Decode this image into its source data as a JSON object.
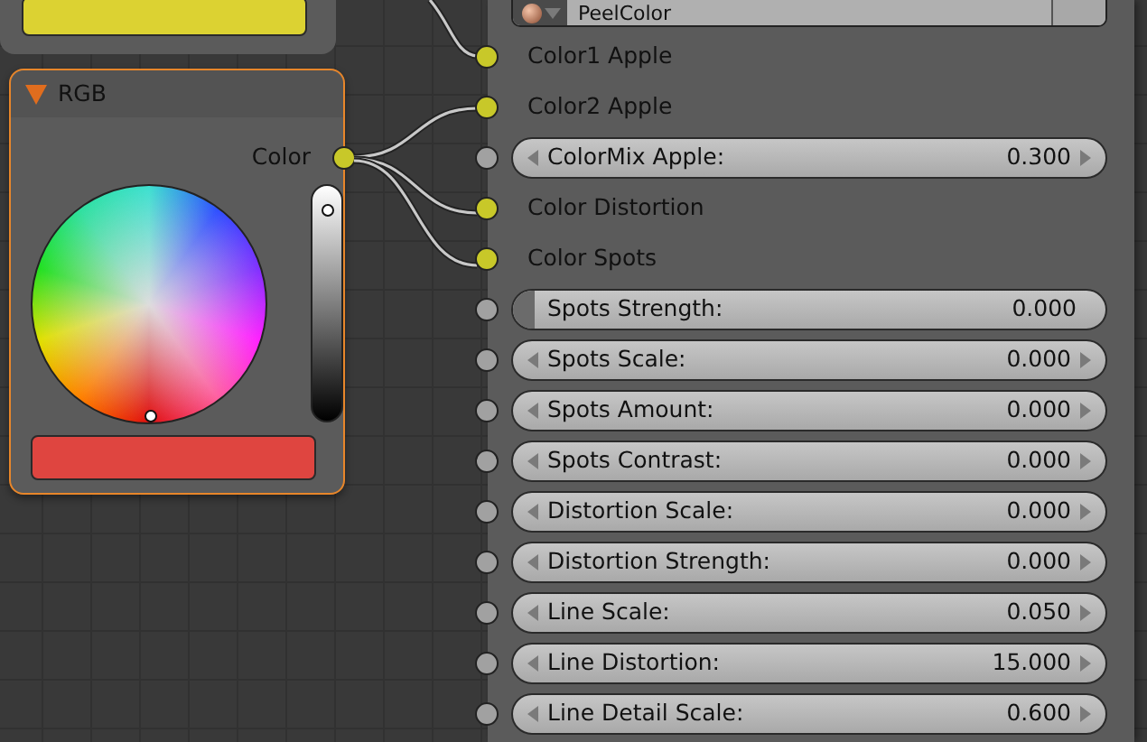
{
  "rgb_node": {
    "title": "RGB",
    "expanded": true,
    "output": "Color",
    "value_slider": {
      "level": 0.93
    }
  },
  "group_node": {
    "datablock": "PeelColor",
    "inputs": [
      {
        "kind": "color",
        "label": "Color1 Apple"
      },
      {
        "kind": "color",
        "label": "Color2 Apple"
      },
      {
        "kind": "number",
        "label": "ColorMix Apple:",
        "value": "0.300"
      },
      {
        "kind": "color",
        "label": "Color Distortion"
      },
      {
        "kind": "color",
        "label": "Color Spots"
      },
      {
        "kind": "slider",
        "label": "Spots Strength:",
        "value": "0.000",
        "level": 0
      },
      {
        "kind": "number",
        "label": "Spots Scale:",
        "value": "0.000"
      },
      {
        "kind": "number",
        "label": "Spots Amount:",
        "value": "0.000"
      },
      {
        "kind": "number",
        "label": "Spots Contrast:",
        "value": "0.000"
      },
      {
        "kind": "number",
        "label": "Distortion Scale:",
        "value": "0.000"
      },
      {
        "kind": "number",
        "label": "Distortion Strength:",
        "value": "0.000"
      },
      {
        "kind": "number",
        "label": "Line Scale:",
        "value": "0.050"
      },
      {
        "kind": "number",
        "label": "Line Distortion:",
        "value": "15.000"
      },
      {
        "kind": "number",
        "label": "Line Detail Scale:",
        "value": "0.600"
      }
    ]
  }
}
